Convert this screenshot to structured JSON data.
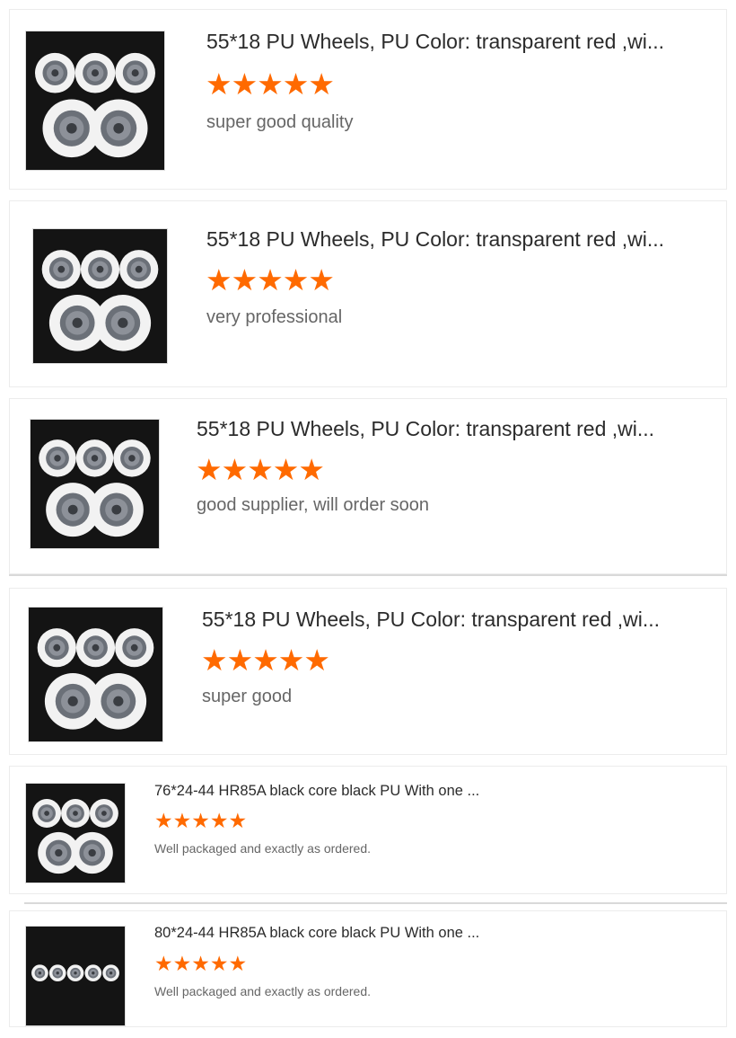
{
  "reviews": [
    {
      "product_title": "55*18 PU Wheels, PU Color: transparent red ,wi...",
      "rating": 5,
      "review_text": "super good quality",
      "thumbnail_icon": "wheels-thumbnail"
    },
    {
      "product_title": "55*18 PU Wheels, PU Color: transparent red ,wi...",
      "rating": 5,
      "review_text": "very professional",
      "thumbnail_icon": "wheels-thumbnail"
    },
    {
      "product_title": "55*18 PU Wheels, PU Color: transparent red ,wi...",
      "rating": 5,
      "review_text": "good supplier, will order soon",
      "thumbnail_icon": "wheels-thumbnail"
    },
    {
      "product_title": "55*18 PU Wheels, PU Color: transparent red ,wi...",
      "rating": 5,
      "review_text": "super good",
      "thumbnail_icon": "wheels-thumbnail"
    },
    {
      "product_title": "76*24-44 HR85A black core black PU With one ...",
      "rating": 5,
      "review_text": "Well packaged and exactly as ordered.",
      "thumbnail_icon": "wheels-thumbnail"
    },
    {
      "product_title": "80*24-44 HR85A black core black PU With one ...",
      "rating": 5,
      "review_text": "Well packaged and exactly as ordered.",
      "thumbnail_icon": "wheels-row-thumbnail"
    }
  ],
  "colors": {
    "star": "#ff6a00",
    "title_text": "#2b2b2b",
    "review_text": "#666666",
    "photo_background": "#141414",
    "wheel": "#f2f2f2",
    "wheel_core": "#6b7078"
  }
}
